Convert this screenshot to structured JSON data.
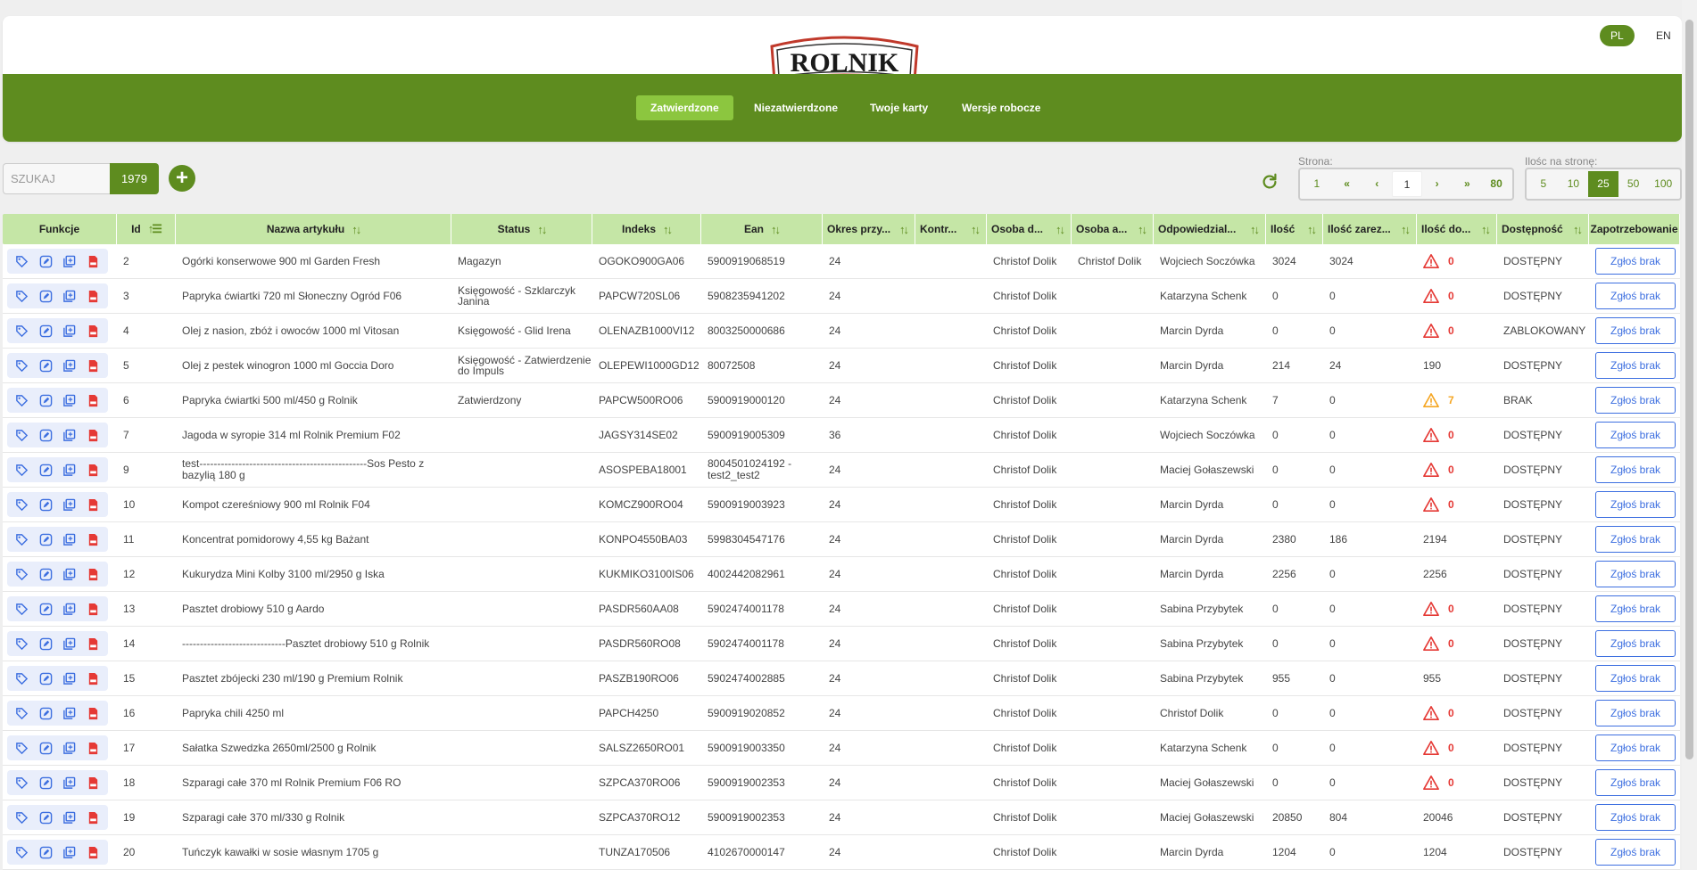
{
  "brand": {
    "logo_text": "ROLNIK",
    "accent": "#5e8c1f",
    "header_highlight": "#8cc63f"
  },
  "lang": {
    "pl": "PL",
    "en": "EN",
    "active": "PL"
  },
  "nav": {
    "tabs": [
      "Zatwierdzone",
      "Niezatwierdzone",
      "Twoje karty",
      "Wersje robocze"
    ],
    "active": "Zatwierdzone"
  },
  "search": {
    "placeholder": "SZUKAJ",
    "value": "",
    "count": "1979",
    "add_icon": "plus-icon"
  },
  "pagination": {
    "label": "Strona:",
    "first": "1",
    "prev_prev": "«",
    "prev": "‹",
    "current": "1",
    "next": "›",
    "next_next": "»",
    "last": "80"
  },
  "per_page": {
    "label": "Ilośc na stronę:",
    "options": [
      "5",
      "10",
      "25",
      "50",
      "100"
    ],
    "selected": "25"
  },
  "table": {
    "headers": [
      "Funkcje",
      "Id",
      "Nazwa artykułu",
      "Status",
      "Indeks",
      "Ean",
      "Okres przy...",
      "Kontr...",
      "Osoba d...",
      "Osoba a...",
      "Odpowiedzial...",
      "Ilość",
      "Ilość zarez...",
      "Ilość do...",
      "Dostępność",
      "Zapotrzebowanie"
    ],
    "report_label": "Zgłoś brak",
    "rows": [
      {
        "id": "2",
        "name": "Ogórki konserwowe 900 ml Garden Fresh",
        "status": "Magazyn",
        "index": "OGOKO900GA06",
        "ean": "5900919068519",
        "okres": "24",
        "kontr": "",
        "osoba_d": "Christof Dolik",
        "osoba_a": "Christof Dolik",
        "odp": "Wojciech Soczówka",
        "ilosc": "3024",
        "zarez": "3024",
        "ilosc_do": "0",
        "warn": "red",
        "dost": "DOSTĘPNY"
      },
      {
        "id": "3",
        "name": "Papryka ćwiartki 720 ml Słoneczny Ogród F06",
        "status": "Księgowość - Szklarczyk Janina",
        "index": "PAPCW720SL06",
        "ean": "5908235941202",
        "okres": "24",
        "kontr": "",
        "osoba_d": "Christof Dolik",
        "osoba_a": "",
        "odp": "Katarzyna Schenk",
        "ilosc": "0",
        "zarez": "0",
        "ilosc_do": "0",
        "warn": "red",
        "dost": "DOSTĘPNY"
      },
      {
        "id": "4",
        "name": "Olej z nasion, zbóż i owoców 1000 ml Vitosan",
        "status": "Księgowość - Glid Irena",
        "index": "OLENAZB1000VI12",
        "ean": "8003250000686",
        "okres": "24",
        "kontr": "",
        "osoba_d": "Christof Dolik",
        "osoba_a": "",
        "odp": "Marcin Dyrda",
        "ilosc": "0",
        "zarez": "0",
        "ilosc_do": "0",
        "warn": "red",
        "dost": "ZABLOKOWANY"
      },
      {
        "id": "5",
        "name": "Olej z pestek winogron 1000 ml Goccia Doro",
        "status": "Księgowość - Zatwierdzenie do Impuls",
        "index": "OLEPEWI1000GD12",
        "ean": "80072508",
        "okres": "24",
        "kontr": "",
        "osoba_d": "Christof Dolik",
        "osoba_a": "",
        "odp": "Marcin Dyrda",
        "ilosc": "214",
        "zarez": "24",
        "ilosc_do": "190",
        "warn": "",
        "dost": "DOSTĘPNY"
      },
      {
        "id": "6",
        "name": "Papryka ćwiartki 500 ml/450 g Rolnik",
        "status": "Zatwierdzony",
        "index": "PAPCW500RO06",
        "ean": "5900919000120",
        "okres": "24",
        "kontr": "",
        "osoba_d": "Christof Dolik",
        "osoba_a": "",
        "odp": "Katarzyna Schenk",
        "ilosc": "7",
        "zarez": "0",
        "ilosc_do": "7",
        "warn": "orange",
        "dost": "BRAK"
      },
      {
        "id": "7",
        "name": "Jagoda w syropie 314 ml Rolnik Premium F02",
        "status": "",
        "index": "JAGSY314SE02",
        "ean": "5900919005309",
        "okres": "36",
        "kontr": "",
        "osoba_d": "Christof Dolik",
        "osoba_a": "",
        "odp": "Wojciech Soczówka",
        "ilosc": "0",
        "zarez": "0",
        "ilosc_do": "0",
        "warn": "red",
        "dost": "DOSTĘPNY"
      },
      {
        "id": "9",
        "name": "test-----------------------------------------------Sos Pesto z bazylią 180 g",
        "status": "",
        "index": "ASOSPEBA18001",
        "ean": "8004501024192 - test2_test2",
        "okres": "24",
        "kontr": "",
        "osoba_d": "Christof Dolik",
        "osoba_a": "",
        "odp": "Maciej Gołaszewski",
        "ilosc": "0",
        "zarez": "0",
        "ilosc_do": "0",
        "warn": "red",
        "dost": "DOSTĘPNY"
      },
      {
        "id": "10",
        "name": "Kompot czereśniowy 900 ml Rolnik F04",
        "status": "",
        "index": "KOMCZ900RO04",
        "ean": "5900919003923",
        "okres": "24",
        "kontr": "",
        "osoba_d": "Christof Dolik",
        "osoba_a": "",
        "odp": "Marcin Dyrda",
        "ilosc": "0",
        "zarez": "0",
        "ilosc_do": "0",
        "warn": "red",
        "dost": "DOSTĘPNY"
      },
      {
        "id": "11",
        "name": "Koncentrat pomidorowy 4,55 kg Bażant",
        "status": "",
        "index": "KONPO4550BA03",
        "ean": "5998304547176",
        "okres": "24",
        "kontr": "",
        "osoba_d": "Christof Dolik",
        "osoba_a": "",
        "odp": "Marcin Dyrda",
        "ilosc": "2380",
        "zarez": "186",
        "ilosc_do": "2194",
        "warn": "",
        "dost": "DOSTĘPNY"
      },
      {
        "id": "12",
        "name": "Kukurydza Mini Kolby 3100 ml/2950 g Iska",
        "status": "",
        "index": "KUKMIKO3100IS06",
        "ean": "4002442082961",
        "okres": "24",
        "kontr": "",
        "osoba_d": "Christof Dolik",
        "osoba_a": "",
        "odp": "Marcin Dyrda",
        "ilosc": "2256",
        "zarez": "0",
        "ilosc_do": "2256",
        "warn": "",
        "dost": "DOSTĘPNY"
      },
      {
        "id": "13",
        "name": "Pasztet drobiowy 510 g Aardo",
        "status": "",
        "index": "PASDR560AA08",
        "ean": "5902474001178",
        "okres": "24",
        "kontr": "",
        "osoba_d": "Christof Dolik",
        "osoba_a": "",
        "odp": "Sabina Przybytek",
        "ilosc": "0",
        "zarez": "0",
        "ilosc_do": "0",
        "warn": "red",
        "dost": "DOSTĘPNY"
      },
      {
        "id": "14",
        "name": "-----------------------------Pasztet drobiowy 510 g Rolnik",
        "status": "",
        "index": "PASDR560RO08",
        "ean": "5902474001178",
        "okres": "24",
        "kontr": "",
        "osoba_d": "Christof Dolik",
        "osoba_a": "",
        "odp": "Sabina Przybytek",
        "ilosc": "0",
        "zarez": "0",
        "ilosc_do": "0",
        "warn": "red",
        "dost": "DOSTĘPNY"
      },
      {
        "id": "15",
        "name": "Pasztet zbójecki 230 ml/190 g Premium Rolnik",
        "status": "",
        "index": "PASZB190RO06",
        "ean": "5902474002885",
        "okres": "24",
        "kontr": "",
        "osoba_d": "Christof Dolik",
        "osoba_a": "",
        "odp": "Sabina Przybytek",
        "ilosc": "955",
        "zarez": "0",
        "ilosc_do": "955",
        "warn": "",
        "dost": "DOSTĘPNY"
      },
      {
        "id": "16",
        "name": "Papryka chili 4250 ml",
        "status": "",
        "index": "PAPCH4250",
        "ean": "5900919020852",
        "okres": "24",
        "kontr": "",
        "osoba_d": "Christof Dolik",
        "osoba_a": "",
        "odp": "Christof Dolik",
        "ilosc": "0",
        "zarez": "0",
        "ilosc_do": "0",
        "warn": "red",
        "dost": "DOSTĘPNY"
      },
      {
        "id": "17",
        "name": "Sałatka Szwedzka 2650ml/2500 g Rolnik",
        "status": "",
        "index": "SALSZ2650RO01",
        "ean": "5900919003350",
        "okres": "24",
        "kontr": "",
        "osoba_d": "Christof Dolik",
        "osoba_a": "",
        "odp": "Katarzyna Schenk",
        "ilosc": "0",
        "zarez": "0",
        "ilosc_do": "0",
        "warn": "red",
        "dost": "DOSTĘPNY"
      },
      {
        "id": "18",
        "name": "Szparagi całe 370 ml Rolnik Premium F06 RO",
        "status": "",
        "index": "SZPCA370RO06",
        "ean": "5900919002353",
        "okres": "24",
        "kontr": "",
        "osoba_d": "Christof Dolik",
        "osoba_a": "",
        "odp": "Maciej Gołaszewski",
        "ilosc": "0",
        "zarez": "0",
        "ilosc_do": "0",
        "warn": "red",
        "dost": "DOSTĘPNY"
      },
      {
        "id": "19",
        "name": "Szparagi całe 370 ml/330 g Rolnik",
        "status": "",
        "index": "SZPCA370RO12",
        "ean": "5900919002353",
        "okres": "24",
        "kontr": "",
        "osoba_d": "Christof Dolik",
        "osoba_a": "",
        "odp": "Maciej Gołaszewski",
        "ilosc": "20850",
        "zarez": "804",
        "ilosc_do": "20046",
        "warn": "",
        "dost": "DOSTĘPNY"
      },
      {
        "id": "20",
        "name": "Tuńczyk kawałki w sosie własnym 1705 g",
        "status": "",
        "index": "TUNZA170506",
        "ean": "4102670000147",
        "okres": "24",
        "kontr": "",
        "osoba_d": "Christof Dolik",
        "osoba_a": "",
        "odp": "Marcin Dyrda",
        "ilosc": "1204",
        "zarez": "0",
        "ilosc_do": "1204",
        "warn": "",
        "dost": "DOSTĘPNY"
      }
    ]
  }
}
